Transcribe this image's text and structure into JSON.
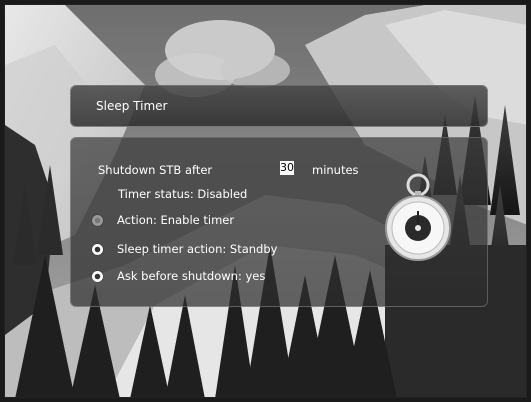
{
  "dialog": {
    "title": "Sleep Timer",
    "shutdown_label": "Shutdown STB after",
    "shutdown_value": "30",
    "shutdown_unit": "minutes",
    "timer_status": "Timer status: Disabled",
    "options": [
      {
        "label": "Action: Enable timer",
        "state": "disabled"
      },
      {
        "label": "Sleep timer action: Standby",
        "state": "enabled"
      },
      {
        "label": "Ask before shutdown: yes",
        "state": "enabled"
      }
    ]
  },
  "icons": {
    "stopwatch": "stopwatch-icon"
  }
}
